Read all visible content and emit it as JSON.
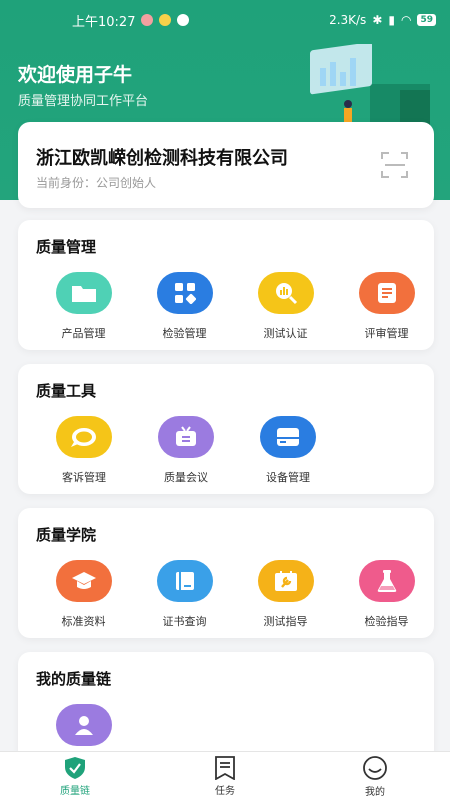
{
  "status_bar": {
    "time": "上午10:27",
    "speed": "2.3K/s",
    "battery": "59"
  },
  "header": {
    "title": "欢迎使用子牛",
    "subtitle": "质量管理协同工作平台"
  },
  "company": {
    "name": "浙江欧凯嵘创检测科技有限公司",
    "role": "当前身份：公司创始人"
  },
  "sections": [
    {
      "title": "质量管理",
      "items": [
        {
          "label": "产品管理",
          "icon": "folder-icon",
          "color": "#4fd1b5"
        },
        {
          "label": "检验管理",
          "icon": "grid-icon",
          "color": "#2a7de1"
        },
        {
          "label": "测试认证",
          "icon": "magnify-chart-icon",
          "color": "#f5c518"
        },
        {
          "label": "评审管理",
          "icon": "document-icon",
          "color": "#f2703d"
        }
      ]
    },
    {
      "title": "质量工具",
      "items": [
        {
          "label": "客诉管理",
          "icon": "chat-icon",
          "color": "#f5c518"
        },
        {
          "label": "质量会议",
          "icon": "tv-icon",
          "color": "#9b7be0"
        },
        {
          "label": "设备管理",
          "icon": "device-icon",
          "color": "#2a7de1"
        }
      ]
    },
    {
      "title": "质量学院",
      "items": [
        {
          "label": "标准资料",
          "icon": "graduation-cap-icon",
          "color": "#f2703d"
        },
        {
          "label": "证书查询",
          "icon": "book-icon",
          "color": "#3aa0e8"
        },
        {
          "label": "测试指导",
          "icon": "wrench-board-icon",
          "color": "#f5b218"
        },
        {
          "label": "检验指导",
          "icon": "flask-icon",
          "color": "#ef5b8c"
        }
      ]
    },
    {
      "title": "我的质量链",
      "items": [
        {
          "label": "",
          "icon": "user-icon",
          "color": "#9b7be0"
        }
      ]
    }
  ],
  "tabs": [
    {
      "label": "质量链",
      "icon": "shield-check-icon",
      "active": true
    },
    {
      "label": "任务",
      "icon": "task-icon",
      "active": false
    },
    {
      "label": "我的",
      "icon": "smile-icon",
      "active": false
    }
  ]
}
